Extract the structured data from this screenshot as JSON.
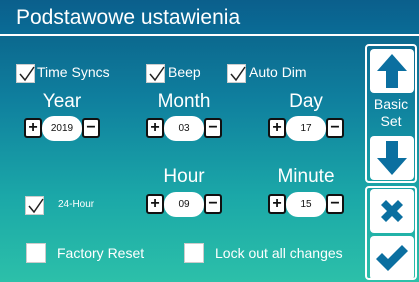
{
  "header": {
    "title": "Podstawowe ustawienia"
  },
  "options": {
    "time_syncs": {
      "label": "Time Syncs",
      "checked": true
    },
    "beep": {
      "label": "Beep",
      "checked": true
    },
    "auto_dim": {
      "label": "Auto Dim",
      "checked": true
    },
    "hour24": {
      "label": "24-Hour",
      "checked": true
    },
    "factory_reset": {
      "label": "Factory Reset",
      "checked": false
    },
    "lock_out": {
      "label": "Lock out all changes",
      "checked": false
    }
  },
  "date": {
    "year": {
      "label": "Year",
      "value": "2019"
    },
    "month": {
      "label": "Month",
      "value": "03"
    },
    "day": {
      "label": "Day",
      "value": "17"
    }
  },
  "time": {
    "hour": {
      "label": "Hour",
      "value": "09"
    },
    "minute": {
      "label": "Minute",
      "value": "15"
    }
  },
  "stepper": {
    "plus": "+",
    "minus": "−"
  },
  "sidebar": {
    "page_label_line1": "Basic",
    "page_label_line2": "Set"
  },
  "icons": {
    "up": "arrow-up-icon",
    "down": "arrow-down-icon",
    "cancel": "x-icon",
    "confirm": "check-icon"
  },
  "colors": {
    "accent": "#0a5c86",
    "icon": "#0b6fa0"
  }
}
